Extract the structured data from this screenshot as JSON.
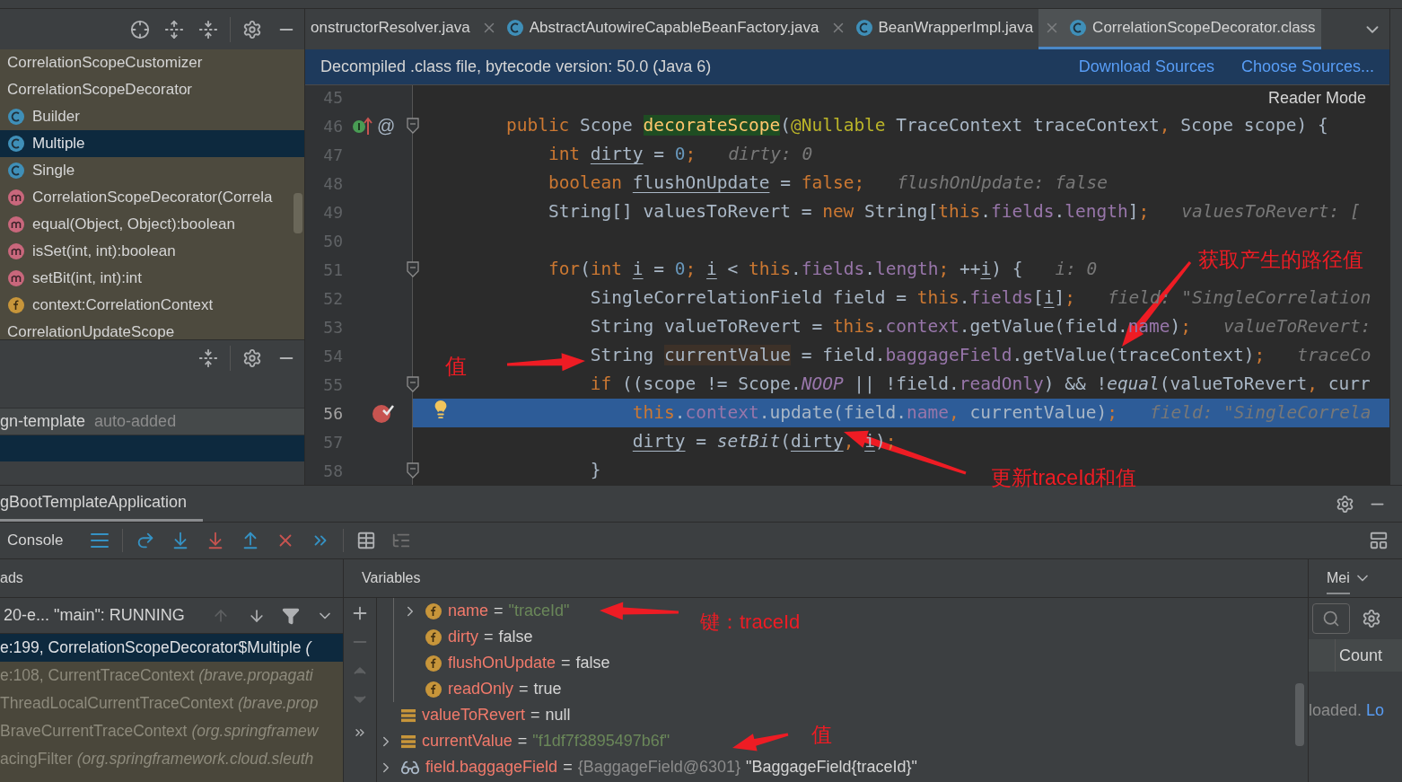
{
  "structure": {
    "items": [
      {
        "label": "CorrelationScopeCustomizer",
        "selected": false
      },
      {
        "label": "CorrelationScopeDecorator",
        "selected": false,
        "children": [
          {
            "label": "Builder",
            "kind": "class",
            "selected": false
          },
          {
            "label": "Multiple",
            "kind": "class",
            "selected": true
          },
          {
            "label": "Single",
            "kind": "class",
            "selected": false
          },
          {
            "label": "CorrelationScopeDecorator(Correla",
            "kind": "method",
            "selected": false
          },
          {
            "label": "equal(Object, Object):boolean",
            "kind": "method",
            "selected": false
          },
          {
            "label": "isSet(int, int):boolean",
            "kind": "method",
            "selected": false
          },
          {
            "label": "setBit(int, int):int",
            "kind": "method",
            "selected": false
          },
          {
            "label": "context:CorrelationContext",
            "kind": "field",
            "selected": false
          }
        ]
      },
      {
        "label": "CorrelationUpdateScope",
        "selected": false
      }
    ]
  },
  "project_list": {
    "rows": [
      {
        "name": "gn-template",
        "note": "auto-added",
        "selected": false
      },
      {
        "selected": true
      }
    ]
  },
  "editor": {
    "tabs": [
      {
        "label": "onstructorResolver.java",
        "selected": false,
        "closable": false
      },
      {
        "label": "AbstractAutowireCapableBeanFactory.java",
        "selected": false,
        "closable": true
      },
      {
        "label": "BeanWrapperImpl.java",
        "selected": false,
        "closable": true
      },
      {
        "label": "CorrelationScopeDecorator.class",
        "selected": true,
        "closable": true
      }
    ],
    "banner": {
      "text": "Decompiled .class file, bytecode version: 50.0 (Java 6)",
      "links": [
        "Download Sources",
        "Choose Sources..."
      ]
    },
    "reader_mode": "Reader Mode",
    "lines": [
      {
        "number": "45",
        "selected": false,
        "breakpoint": false,
        "fold": false
      },
      {
        "number": "46",
        "selected": false,
        "breakpoint": false,
        "fold": true,
        "implements": true,
        "gutter_text": "@",
        "tokens": [
          {
            "kind": "kw",
            "text": "        public"
          },
          {
            "kind": "plain",
            "text": " Scope "
          },
          {
            "kind": "decl",
            "text": "decorateScope"
          },
          {
            "kind": "plain",
            "text": "("
          },
          {
            "kind": "ann",
            "text": "@Nullable"
          },
          {
            "kind": "plain",
            "text": " TraceContext traceContext"
          },
          {
            "kind": "punct",
            "text": ","
          },
          {
            "kind": "plain",
            "text": " Scope scope) {"
          }
        ]
      },
      {
        "number": "47",
        "selected": false,
        "breakpoint": false,
        "fold": false,
        "hint": "dirty: 0",
        "tokens": [
          {
            "kind": "kw",
            "text": "            int "
          },
          {
            "kind": "var",
            "text": "dirty"
          },
          {
            "kind": "plain",
            "text": " = "
          },
          {
            "kind": "num",
            "text": "0"
          },
          {
            "kind": "punct",
            "text": ";"
          }
        ]
      },
      {
        "number": "48",
        "selected": false,
        "breakpoint": false,
        "fold": false,
        "hint": "flushOnUpdate: false",
        "tokens": [
          {
            "kind": "kw",
            "text": "            boolean "
          },
          {
            "kind": "var",
            "text": "flushOnUpdate"
          },
          {
            "kind": "plain",
            "text": " = "
          },
          {
            "kind": "kw",
            "text": "false"
          },
          {
            "kind": "punct",
            "text": ";"
          }
        ]
      },
      {
        "number": "49",
        "selected": false,
        "breakpoint": false,
        "fold": false,
        "hint": "valuesToRevert: [",
        "tokens": [
          {
            "kind": "plain",
            "text": "            String[] valuesToRevert = "
          },
          {
            "kind": "kw",
            "text": "new"
          },
          {
            "kind": "plain",
            "text": " String["
          },
          {
            "kind": "kw",
            "text": "this"
          },
          {
            "kind": "plain",
            "text": "."
          },
          {
            "kind": "field",
            "text": "fields"
          },
          {
            "kind": "plain",
            "text": "."
          },
          {
            "kind": "field",
            "text": "length"
          },
          {
            "kind": "plain",
            "text": "]"
          },
          {
            "kind": "punct",
            "text": ";"
          }
        ]
      },
      {
        "number": "50",
        "selected": false,
        "breakpoint": false,
        "fold": false
      },
      {
        "number": "51",
        "selected": false,
        "breakpoint": false,
        "fold": true,
        "hint": "i: 0",
        "tokens": [
          {
            "kind": "kw",
            "text": "            for"
          },
          {
            "kind": "plain",
            "text": "("
          },
          {
            "kind": "kw",
            "text": "int "
          },
          {
            "kind": "var",
            "text": "i"
          },
          {
            "kind": "plain",
            "text": " = "
          },
          {
            "kind": "num",
            "text": "0"
          },
          {
            "kind": "punct",
            "text": "; "
          },
          {
            "kind": "var",
            "text": "i"
          },
          {
            "kind": "plain",
            "text": " < "
          },
          {
            "kind": "kw",
            "text": "this"
          },
          {
            "kind": "plain",
            "text": "."
          },
          {
            "kind": "field",
            "text": "fields"
          },
          {
            "kind": "plain",
            "text": "."
          },
          {
            "kind": "field",
            "text": "length"
          },
          {
            "kind": "punct",
            "text": ";"
          },
          {
            "kind": "plain",
            "text": " ++"
          },
          {
            "kind": "var",
            "text": "i"
          },
          {
            "kind": "plain",
            "text": ") {"
          }
        ]
      },
      {
        "number": "52",
        "selected": false,
        "breakpoint": false,
        "fold": false,
        "hint": "field: \"SingleCorrelation",
        "tokens": [
          {
            "kind": "plain",
            "text": "                SingleCorrelationField field = "
          },
          {
            "kind": "kw",
            "text": "this"
          },
          {
            "kind": "plain",
            "text": "."
          },
          {
            "kind": "field",
            "text": "fields"
          },
          {
            "kind": "plain",
            "text": "["
          },
          {
            "kind": "var",
            "text": "i"
          },
          {
            "kind": "plain",
            "text": "]"
          },
          {
            "kind": "punct",
            "text": ";"
          }
        ]
      },
      {
        "number": "53",
        "selected": false,
        "breakpoint": false,
        "fold": false,
        "hint": "valueToRevert:",
        "tokens": [
          {
            "kind": "plain",
            "text": "                String valueToRevert = "
          },
          {
            "kind": "kw",
            "text": "this"
          },
          {
            "kind": "plain",
            "text": "."
          },
          {
            "kind": "field",
            "text": "context"
          },
          {
            "kind": "plain",
            "text": ".getValue(field."
          },
          {
            "kind": "field",
            "text": "name"
          },
          {
            "kind": "plain",
            "text": ")"
          },
          {
            "kind": "punct",
            "text": ";"
          }
        ]
      },
      {
        "number": "54",
        "selected": false,
        "breakpoint": false,
        "fold": false,
        "hint": "traceCo",
        "tokens": [
          {
            "kind": "plain",
            "text": "                String "
          },
          {
            "kind": "hl",
            "text": "currentValue"
          },
          {
            "kind": "plain",
            "text": " = field."
          },
          {
            "kind": "field",
            "text": "baggageField"
          },
          {
            "kind": "plain",
            "text": ".getValue(traceContext)"
          },
          {
            "kind": "punct",
            "text": ";"
          }
        ]
      },
      {
        "number": "55",
        "selected": false,
        "breakpoint": false,
        "fold": true,
        "tokens": [
          {
            "kind": "kw",
            "text": "                if"
          },
          {
            "kind": "plain",
            "text": " ((scope != Scope."
          },
          {
            "kind": "static",
            "text": "NOOP"
          },
          {
            "kind": "plain",
            "text": " || !field."
          },
          {
            "kind": "field",
            "text": "readOnly"
          },
          {
            "kind": "plain",
            "text": ") && !"
          },
          {
            "kind": "call",
            "text": "equal"
          },
          {
            "kind": "plain",
            "text": "(valueToRevert"
          },
          {
            "kind": "punct",
            "text": ","
          },
          {
            "kind": "plain",
            "text": " curr"
          }
        ]
      },
      {
        "number": "56",
        "selected": true,
        "breakpoint": true,
        "fold": false,
        "intention": true,
        "hint": "field: \"SingleCorrela",
        "tokens": [
          {
            "kind": "kw",
            "text": "                    this"
          },
          {
            "kind": "plain",
            "text": "."
          },
          {
            "kind": "field",
            "text": "context"
          },
          {
            "kind": "plain",
            "text": ".update(field."
          },
          {
            "kind": "field",
            "text": "name"
          },
          {
            "kind": "punct",
            "text": ","
          },
          {
            "kind": "plain",
            "text": " currentValue)"
          },
          {
            "kind": "punct",
            "text": ";"
          }
        ]
      },
      {
        "number": "57",
        "selected": false,
        "breakpoint": false,
        "fold": false,
        "tokens": [
          {
            "kind": "var",
            "text": "                    dirty"
          },
          {
            "kind": "plain",
            "text": " = "
          },
          {
            "kind": "call",
            "text": "setBit"
          },
          {
            "kind": "plain",
            "text": "("
          },
          {
            "kind": "var",
            "text": "dirty"
          },
          {
            "kind": "punct",
            "text": ", "
          },
          {
            "kind": "var",
            "text": "i"
          },
          {
            "kind": "plain",
            "text": ")"
          },
          {
            "kind": "punct",
            "text": ";"
          }
        ]
      },
      {
        "number": "58",
        "selected": false,
        "breakpoint": false,
        "fold": true,
        "tokens": [
          {
            "kind": "plain",
            "text": "                }"
          }
        ]
      }
    ]
  },
  "debug": {
    "session_tab": "gBootTemplateApplication",
    "console_tab": "Console",
    "frames": {
      "header": "ads",
      "thread": "20-e... \"main\": RUNNING",
      "rows": [
        {
          "location": "e:199, CorrelationScopeDecorator$Multiple",
          "package": "(",
          "selected": true
        },
        {
          "location": "e:108, CurrentTraceContext",
          "package": "(brave.propagati",
          "selected": false
        },
        {
          "location": "ThreadLocalCurrentTraceContext",
          "package": "(brave.prop",
          "selected": false
        },
        {
          "location": "BraveCurrentTraceContext",
          "package": "(org.springframew",
          "selected": false
        },
        {
          "location": "acingFilter",
          "package": "(org.springframework.cloud.sleuth",
          "selected": false
        }
      ]
    },
    "variables": {
      "header": "Variables",
      "nested_rows": [
        {
          "kind": "field",
          "name": "name",
          "op": "=",
          "value": "\"traceId\"",
          "string": true,
          "expandable": true
        },
        {
          "kind": "field",
          "name": "dirty",
          "op": "=",
          "value": "false",
          "string": false,
          "expandable": false
        },
        {
          "kind": "field",
          "name": "flushOnUpdate",
          "op": "=",
          "value": "false",
          "string": false,
          "expandable": false
        },
        {
          "kind": "field",
          "name": "readOnly",
          "op": "=",
          "value": "true",
          "string": false,
          "expandable": false
        }
      ],
      "rows": [
        {
          "kind": "local",
          "name": "valueToRevert",
          "op": "=",
          "value": "null",
          "string": false,
          "expandable": false
        },
        {
          "kind": "local",
          "name": "currentValue",
          "op": "=",
          "value": "\"f1df7f3895497b6f\"",
          "string": true,
          "expandable": true
        },
        {
          "kind": "watch",
          "name": "field.baggageField",
          "op": "=",
          "ref": "{BaggageField@6301}",
          "value": "\"BaggageField{traceId}\"",
          "string": false,
          "expandable": true
        }
      ]
    },
    "memory": {
      "tab": "Mei",
      "column": "Count",
      "status": "loaded.",
      "link": "Lo"
    }
  },
  "annotations": [
    {
      "kind": "text",
      "text": "值"
    },
    {
      "kind": "text",
      "text": "获取产生的路径值"
    },
    {
      "kind": "text",
      "text": "更新traceId和值"
    },
    {
      "kind": "text",
      "text": "键：traceId"
    },
    {
      "kind": "text",
      "text": "值"
    }
  ]
}
